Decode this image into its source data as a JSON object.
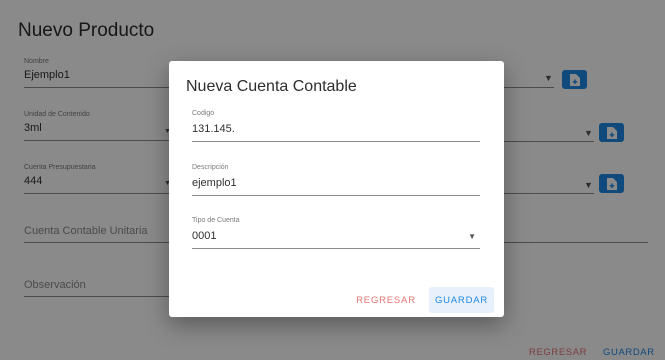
{
  "page": {
    "title": "Nuevo Producto",
    "fields": {
      "nombre": {
        "label": "Nombre",
        "value": "Ejemplo1"
      },
      "unidad": {
        "label": "Unidad de Contenido",
        "value": "3ml"
      },
      "cuenta_presupuestaria": {
        "label": "Cuenta Presupuestaria",
        "value": "444"
      },
      "cuenta_contable_unitaria": {
        "placeholder": "Cuenta Contable Unitaria"
      },
      "observacion": {
        "placeholder": "Observación"
      }
    },
    "actions": {
      "back_label": "REGRESAR",
      "save_label": "GUARDAR"
    }
  },
  "dialog": {
    "title": "Nueva Cuenta Contable",
    "fields": {
      "codigo": {
        "label": "Codigo",
        "value": "131.145."
      },
      "descripcion": {
        "label": "Descripción",
        "value": "ejemplo1"
      },
      "tipo": {
        "label": "Tipo de Cuenta",
        "value": "0001"
      }
    },
    "actions": {
      "back_label": "REGRESAR",
      "save_label": "GUARDAR"
    }
  },
  "icons": {
    "select": "caret-down-icon",
    "document": "add-document-icon"
  },
  "colors": {
    "primary": "#1e88e5",
    "danger": "#e57373",
    "overlay": "rgba(0,0,0,0.46)"
  }
}
